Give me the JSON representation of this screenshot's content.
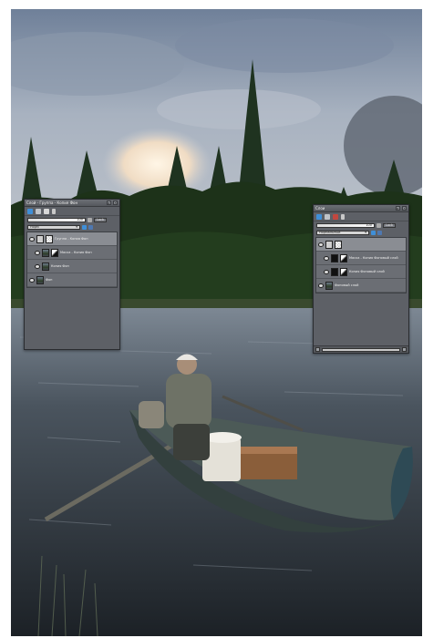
{
  "colors": {
    "panel_bg": "#5d6066",
    "sky": "#9aa6b7",
    "water": "#2b3138",
    "forest": "#1d3219",
    "boat": "#4c5a57"
  },
  "left_panel": {
    "title": "Слой - Группа - Копия Фон",
    "opacity": "100",
    "lock_label": "Lock",
    "blend_mode": "Норм",
    "layers": [
      {
        "name": "Группа - Копия Фон"
      },
      {
        "name": "Маска - Копия Фон"
      },
      {
        "name": "Копия Фон"
      },
      {
        "name": "Фон"
      }
    ]
  },
  "right_panel": {
    "title": "Слои",
    "opacity": "100",
    "lock_label": "Lock",
    "blend_mode": "Нормальный",
    "layers": [
      {
        "name": ""
      },
      {
        "name": "Маска - Копия Фоновый слой"
      },
      {
        "name": "Копия Фоновый слой"
      },
      {
        "name": "Фоновый слой"
      }
    ]
  }
}
